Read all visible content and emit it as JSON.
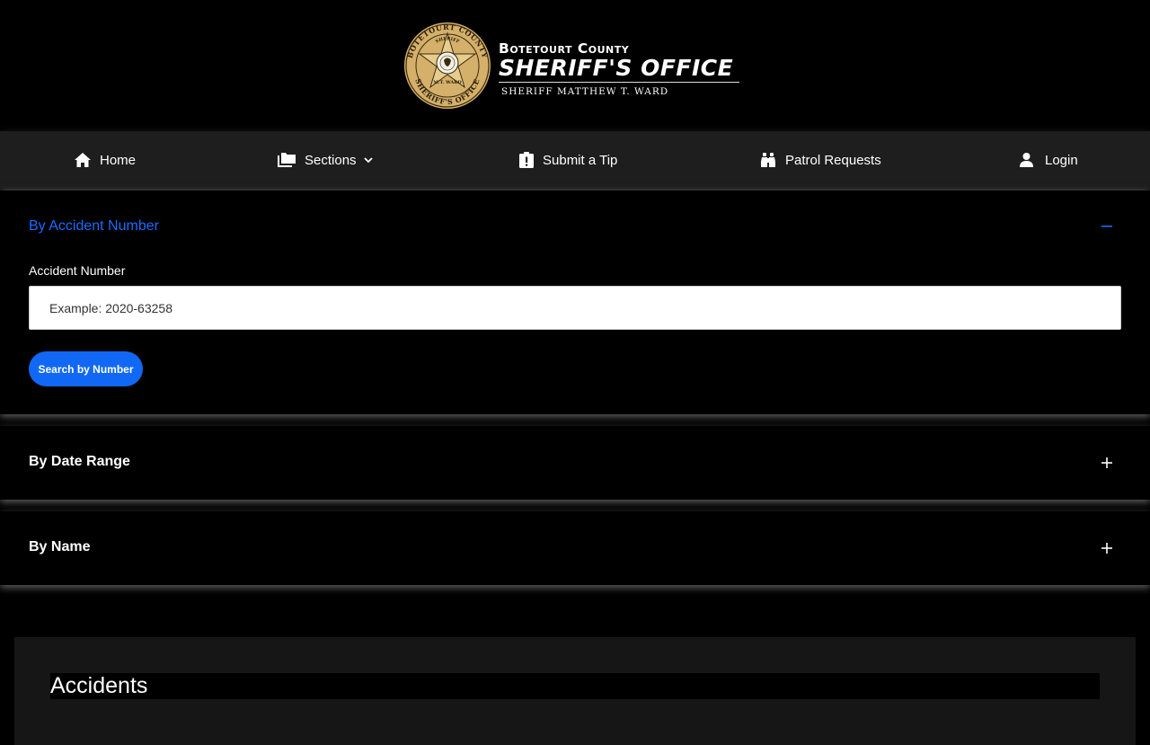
{
  "header": {
    "logo": {
      "county": "Botetourt County",
      "office": "SHERIFF'S OFFICE",
      "sheriff": "SHERIFF MATTHEW T. WARD",
      "badge_text": [
        "BOTETOURT COUNTY",
        "SHERIFF",
        "M.T. WARD",
        "SHERIFF'S OFFICE"
      ]
    }
  },
  "nav": {
    "items": [
      {
        "label": "Home",
        "icon": "home-icon"
      },
      {
        "label": "Sections",
        "icon": "folders-icon",
        "has_dropdown": true
      },
      {
        "label": "Submit a Tip",
        "icon": "clipboard-alert-icon"
      },
      {
        "label": "Patrol Requests",
        "icon": "binoculars-icon"
      },
      {
        "label": "Login",
        "icon": "user-icon"
      }
    ]
  },
  "search": {
    "by_number": {
      "title": "By Accident Number",
      "expanded": true,
      "field_label": "Accident Number",
      "placeholder": "Example: 2020-63258",
      "button_label": "Search by Number"
    },
    "by_date": {
      "title": "By Date Range",
      "expanded": false
    },
    "by_name": {
      "title": "By Name",
      "expanded": false
    }
  },
  "results": {
    "title": "Accidents"
  },
  "colors": {
    "accent_blue": "#1168f5",
    "title_blue": "#1a6cff",
    "nav_bg": "#1e1e1e",
    "page_bg": "#000000",
    "card_bg": "#161616",
    "badge_gold": "#d4b06a"
  }
}
